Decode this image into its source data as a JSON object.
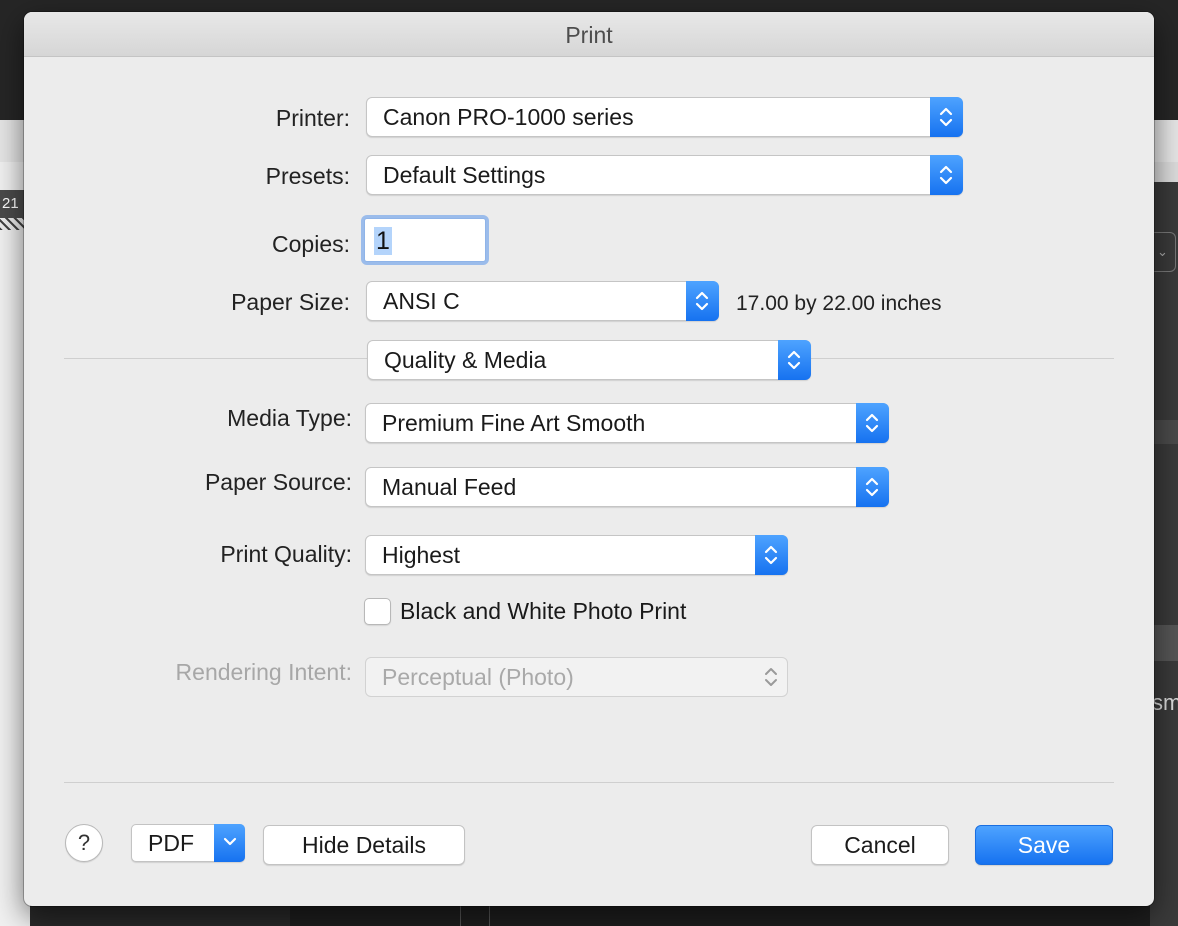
{
  "dialog": {
    "title": "Print"
  },
  "background": {
    "left_tab_text": "21",
    "right_edge_text": "sme"
  },
  "printer": {
    "label": "Printer:",
    "value": "Canon PRO-1000 series"
  },
  "presets": {
    "label": "Presets:",
    "value": "Default Settings"
  },
  "copies": {
    "label": "Copies:",
    "value": "1"
  },
  "paper_size": {
    "label": "Paper Size:",
    "value": "ANSI C",
    "hint": "17.00 by 22.00 inches"
  },
  "section": {
    "value": "Quality & Media"
  },
  "media_type": {
    "label": "Media Type:",
    "value": "Premium Fine Art Smooth"
  },
  "paper_source": {
    "label": "Paper Source:",
    "value": "Manual Feed"
  },
  "print_quality": {
    "label": "Print Quality:",
    "value": "Highest"
  },
  "bw_photo": {
    "label": "Black and White Photo Print",
    "checked": false
  },
  "rendering_intent": {
    "label": "Rendering Intent:",
    "value": "Perceptual (Photo)",
    "enabled": false
  },
  "footer": {
    "help_label": "?",
    "pdf_label": "PDF",
    "hide_details_label": "Hide Details",
    "cancel_label": "Cancel",
    "save_label": "Save"
  },
  "colors": {
    "accent": "#1672f0",
    "sheet": "#ececec"
  },
  "icons": {
    "stepper": "up-down-chevron-icon",
    "pdf_menu": "chevron-down-icon"
  }
}
